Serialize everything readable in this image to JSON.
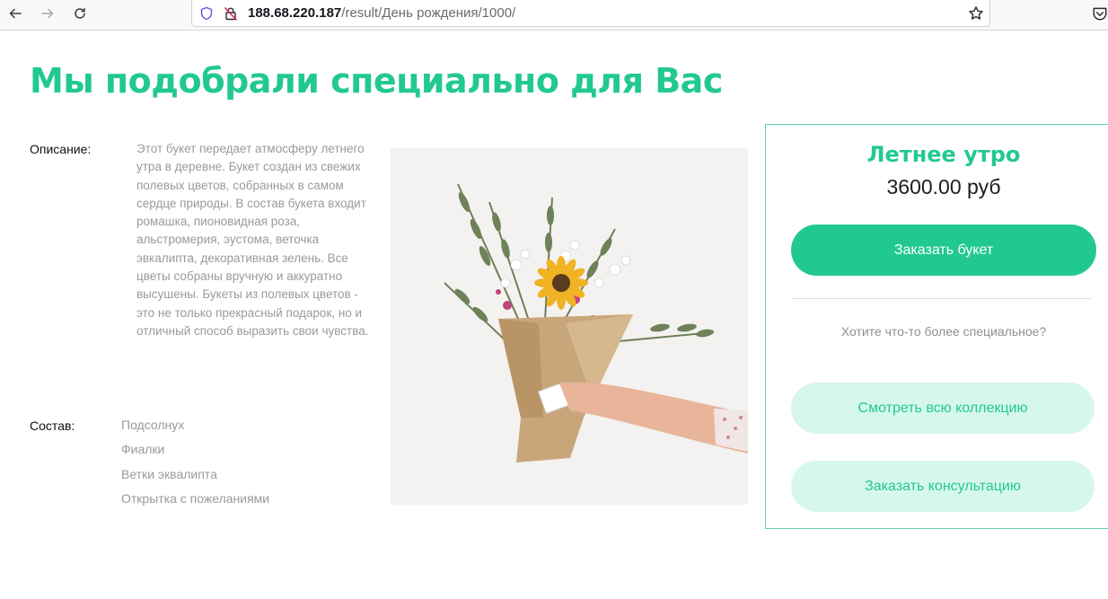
{
  "browser": {
    "url_host": "188.68.220.187",
    "url_path": "/result/День рождения/1000/",
    "icons": [
      "back-icon",
      "forward-icon",
      "reload-icon",
      "shield-icon",
      "insecure-lock-icon",
      "bookmark-star-icon",
      "pocket-icon"
    ]
  },
  "page": {
    "title": "Мы подобрали специально для Вас",
    "description_label": "Описание:",
    "description": "Этот букет передает атмосферу летнего утра в деревне. Букет создан из свежих полевых цветов, собранных в самом сердце природы. В состав букета входит ромашка, пионовидная роза, альстромерия, эустома, веточка эвкалипта, декоративная зелень. Все цветы собраны вручную и аккуратно высушены. Букеты из полевых цветов - это не только прекрасный подарок, но и отличный способ выразить свои чувства.",
    "composition_label": "Состав:",
    "composition": [
      "Подсолнух",
      "Фиалки",
      "Ветки эквалипта",
      "Открытка с пожеланиями"
    ]
  },
  "card": {
    "name": "Летнее утро",
    "price": "3600.00 руб",
    "order_label": "Заказать букет",
    "special_text": "Хотите что-то более специальное?",
    "collection_label": "Смотреть всю коллекцию",
    "consult_label": "Заказать консультацию"
  },
  "colors": {
    "accent": "#22c98f",
    "accent_light": "#d6f7ec",
    "muted_text": "#9a9a9a"
  }
}
